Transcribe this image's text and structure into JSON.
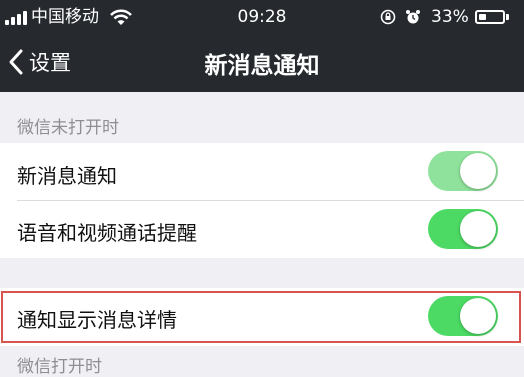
{
  "status_bar": {
    "carrier": "中国移动",
    "time": "09:28",
    "battery": "33%",
    "battery_level": 0.33
  },
  "nav": {
    "back_label": "设置",
    "title": "新消息通知"
  },
  "sections": [
    {
      "header": "微信未打开时",
      "rows": [
        {
          "label": "新消息通知",
          "on": true,
          "dimmed": true
        },
        {
          "label": "语音和视频通话提醒",
          "on": true,
          "dimmed": false
        }
      ]
    },
    {
      "header": "",
      "rows": [
        {
          "label": "通知显示消息详情",
          "on": true,
          "dimmed": false,
          "highlighted": true
        }
      ]
    },
    {
      "header": "微信打开时",
      "rows": []
    }
  ],
  "colors": {
    "nav_bg": "#262a2f",
    "switch_on": "#4cd964",
    "highlight_border": "#d9534f",
    "group_bg": "#efeff4"
  }
}
